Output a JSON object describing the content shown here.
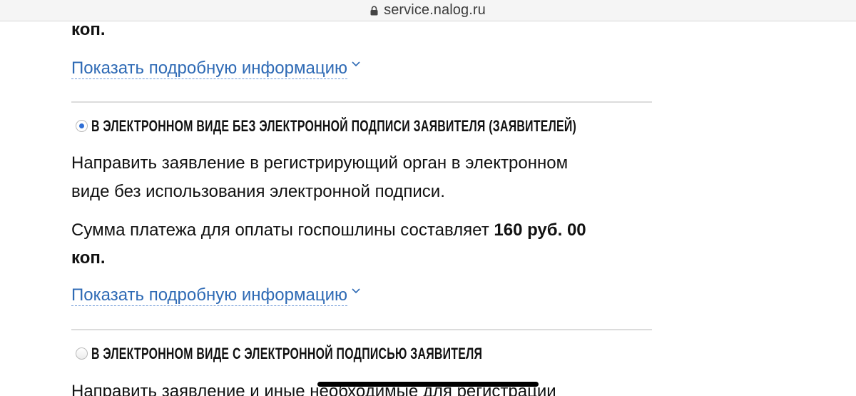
{
  "browser": {
    "url": "service.nalog.ru"
  },
  "top_section": {
    "tail_text": "коп.",
    "more_link": "Показать подробную информацию"
  },
  "option_no_signature": {
    "selected": true,
    "title": "В ЭЛЕКТРОННОМ ВИДЕ БЕЗ ЭЛЕКТРОННОЙ ПОДПИСИ ЗАЯВИТЕЛЯ (ЗАЯВИТЕЛЕЙ)",
    "description_line1": "Направить заявление в регистрирующий орган в электронном",
    "description_line2": "виде без использования электронной подписи.",
    "fee_prefix": "Сумма платежа для оплаты госпошлины составляет",
    "fee_amount": "160 руб. 00",
    "fee_tail": "коп.",
    "more_link": "Показать подробную информацию"
  },
  "option_with_signature": {
    "selected": false,
    "title": "В ЭЛЕКТРОННОМ ВИДЕ С ЭЛЕКТРОННОЙ ПОДПИСЬЮ ЗАЯВИТЕЛЯ",
    "description_partial": "Направить заявление и иные необходимые для регистрации"
  },
  "colors": {
    "link": "#2e6ab5",
    "radio_selected": "#2f6fd6",
    "divider": "#dcdcdc"
  }
}
